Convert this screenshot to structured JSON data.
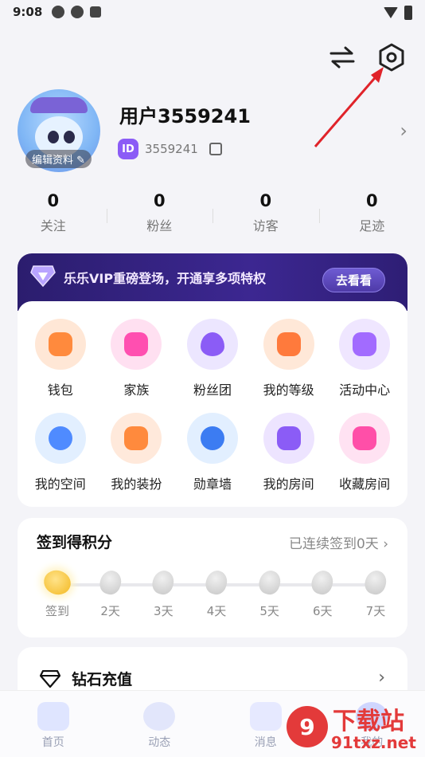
{
  "status_bar": {
    "time": "9:08"
  },
  "profile": {
    "username": "用户3559241",
    "id_badge": "ID",
    "user_id": "3559241",
    "edit_label": "编辑资料"
  },
  "stats": [
    {
      "value": "0",
      "label": "关注"
    },
    {
      "value": "0",
      "label": "粉丝"
    },
    {
      "value": "0",
      "label": "访客"
    },
    {
      "value": "0",
      "label": "足迹"
    }
  ],
  "vip": {
    "text": "乐乐VIP重磅登场，开通享多项特权",
    "button": "去看看"
  },
  "features": [
    {
      "label": "钱包",
      "icon": "wallet-icon",
      "bg": "#ffe7d6",
      "fg": "#ff8a3d"
    },
    {
      "label": "家族",
      "icon": "family-icon",
      "bg": "#ffe0f1",
      "fg": "#ff4fb0"
    },
    {
      "label": "粉丝团",
      "icon": "fan-group-icon",
      "bg": "#ece6ff",
      "fg": "#8b5cf6"
    },
    {
      "label": "我的等级",
      "icon": "level-icon",
      "bg": "#ffe8d8",
      "fg": "#ff7a3c"
    },
    {
      "label": "活动中心",
      "icon": "gift-icon",
      "bg": "#efe6ff",
      "fg": "#a26bff"
    },
    {
      "label": "我的空间",
      "icon": "planet-icon",
      "bg": "#e2efff",
      "fg": "#4f8bff"
    },
    {
      "label": "我的装扮",
      "icon": "outfit-icon",
      "bg": "#ffe9db",
      "fg": "#ff8a3d"
    },
    {
      "label": "勋章墙",
      "icon": "medal-icon",
      "bg": "#e2efff",
      "fg": "#3c7cf2"
    },
    {
      "label": "我的房间",
      "icon": "room-icon",
      "bg": "#ede4ff",
      "fg": "#8b5cf6"
    },
    {
      "label": "收藏房间",
      "icon": "star-room-icon",
      "bg": "#ffe2f2",
      "fg": "#ff4fa8"
    }
  ],
  "checkin": {
    "title": "签到得积分",
    "status": "已连续签到0天",
    "days": [
      "签到",
      "2天",
      "3天",
      "4天",
      "5天",
      "6天",
      "7天"
    ]
  },
  "diamond": {
    "label": "钻石充值"
  },
  "tabs": [
    {
      "label": "首页",
      "icon": "music-note-icon",
      "color": "#b8c6ff"
    },
    {
      "label": "动态",
      "icon": "planet-icon",
      "color": "#c6cffb"
    },
    {
      "label": "消息",
      "icon": "sparkle-icon",
      "color": "#cfd7ff"
    },
    {
      "label": "我的",
      "icon": "profile-icon",
      "color": "#9aa9ff"
    }
  ],
  "watermark": {
    "text": "下载站",
    "domain": "91txz.net"
  }
}
